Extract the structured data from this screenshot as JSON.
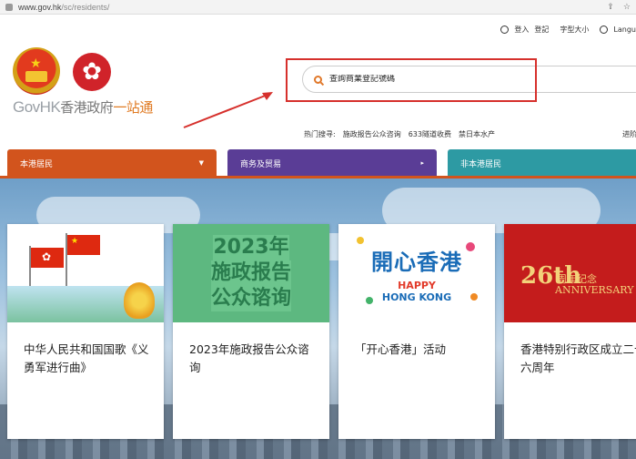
{
  "browser": {
    "url_domain": "www.gov.hk",
    "url_path": "/sc/residents/"
  },
  "header": {
    "login": "登入",
    "register": "登記",
    "font_size": "字型大小",
    "language": "Langu"
  },
  "logo": {
    "brand": "GovHK",
    "brand_zh": "香港政府",
    "brand_zh_accent": "一站通"
  },
  "search": {
    "placeholder": "查詢商業登記號碼"
  },
  "hot_search": {
    "label": "热门搜寻:",
    "items": [
      "施政报告公众咨询",
      "633隧道收费",
      "禁日本水产"
    ],
    "more": "进阶"
  },
  "tabs": [
    {
      "label": "本港居民",
      "caret": "▼"
    },
    {
      "label": "商务及贸易",
      "caret": "▸"
    },
    {
      "label": "非本港居民",
      "caret": ""
    }
  ],
  "cards": [
    {
      "title": "中华人民共和国国歌《义勇军进行曲》"
    },
    {
      "title": "2023年施政报告公众谘询",
      "image_lines": [
        "2023年",
        "施政报告",
        "公众谘询"
      ]
    },
    {
      "title": "「开心香港」活动",
      "image_zh": "開心香港",
      "image_en1": "HAPPY",
      "image_en2": "HONG KONG"
    },
    {
      "title": "香港特别行政区成立二十六周年",
      "image_big": "26th",
      "image_anniv_zh": "周年纪念",
      "image_anniv_en": "ANNIVERSARY"
    }
  ],
  "colors": {
    "tab_residents": "#d2541d",
    "tab_business": "#5a3d96",
    "tab_nonresidents": "#2d9aa3",
    "highlight": "#d6302c"
  }
}
